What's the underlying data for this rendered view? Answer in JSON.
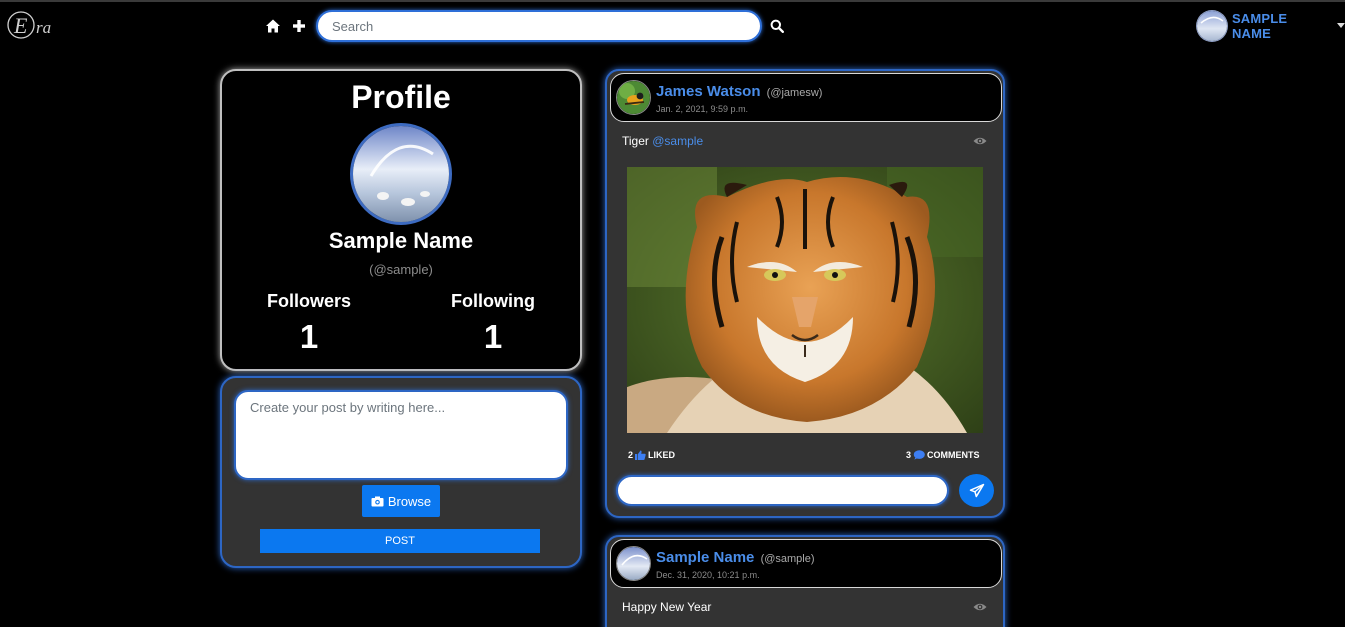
{
  "header": {
    "brand": "Era",
    "home_icon": "home-icon",
    "add_icon": "plus-icon",
    "search_placeholder": "Search",
    "search_icon": "search-icon",
    "user_name": "SAMPLE NAME"
  },
  "profile": {
    "title": "Profile",
    "name": "Sample Name",
    "handle": "(@sample)",
    "followers_label": "Followers",
    "followers_count": "1",
    "following_label": "Following",
    "following_count": "1"
  },
  "composer": {
    "placeholder": "Create your post by writing here...",
    "browse_label": "Browse",
    "post_label": "POST"
  },
  "posts": [
    {
      "author": "James Watson",
      "handle": "(@jamesw)",
      "date": "Jan. 2, 2021, 9:59 p.m.",
      "text": "Tiger",
      "mention": "@sample",
      "likes": "2",
      "likes_label": "LIKED",
      "comments": "3",
      "comments_label": "COMMENTS"
    },
    {
      "author": "Sample Name",
      "handle": "(@sample)",
      "date": "Dec. 31, 2020, 10:21 p.m.",
      "text": "Happy New Year"
    }
  ],
  "colors": {
    "accent": "#0b78f0",
    "link": "#4a8de9",
    "card_bg": "#333333",
    "page_bg": "#000000"
  }
}
